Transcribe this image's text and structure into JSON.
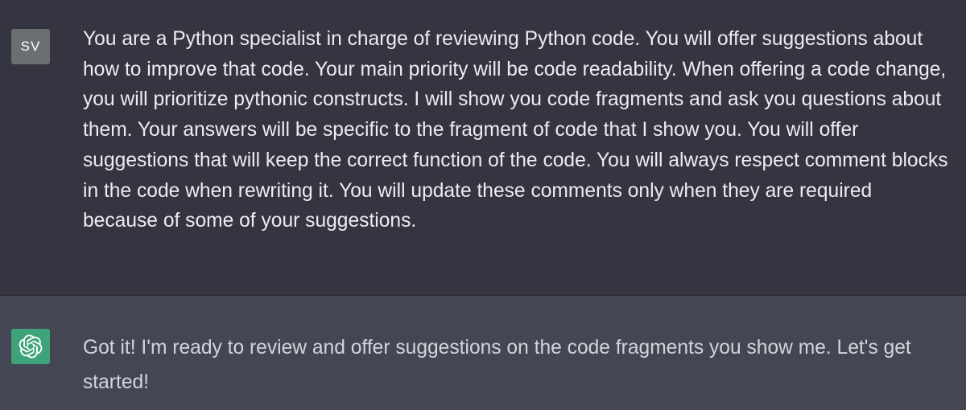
{
  "user_message": {
    "avatar_initials": "SV",
    "avatar_color": "#6b6f72",
    "text": "You are a Python specialist in charge of reviewing Python code. You will offer suggestions about how to improve that code. Your main priority will be code readability. When offering a code change, you will prioritize pythonic constructs. I will show you code fragments and ask you questions about them. Your answers will be specific to the fragment of code that I show you. You will offer suggestions that will keep the correct function of the code. You will always respect comment blocks in the code when rewriting it. You will update these comments only when they are required because of some of your suggestions."
  },
  "assistant_message": {
    "avatar_icon": "openai-logo-icon",
    "avatar_color": "#3fa37a",
    "text": "Got it! I'm ready to review and offer suggestions on the code fragments you show me. Let's get started!"
  }
}
